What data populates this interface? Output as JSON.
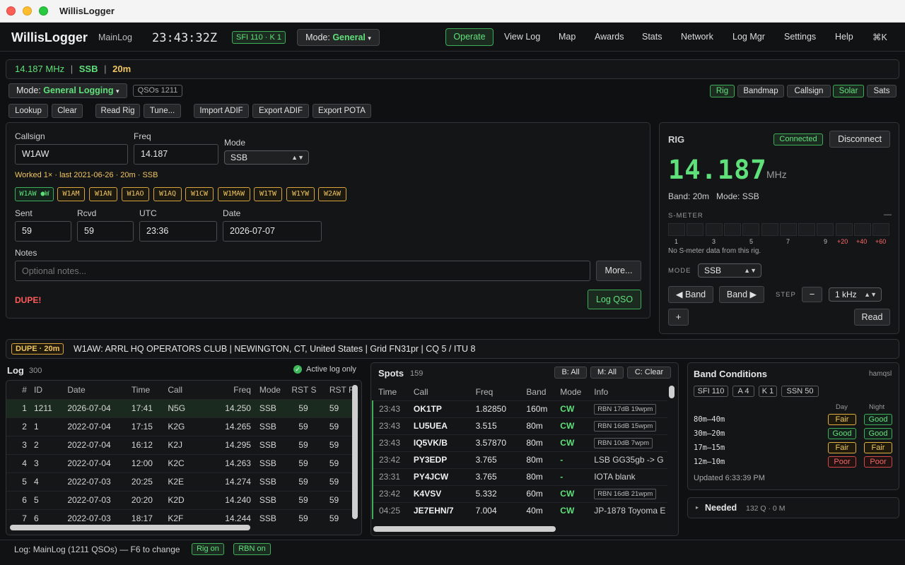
{
  "window": {
    "title": "WillisLogger"
  },
  "header": {
    "app_name": "WillisLogger",
    "log_name": "MainLog",
    "clock": "23:43:32Z",
    "sfi_badge": "SFI 110 · K 1",
    "mode_label": "Mode:",
    "mode_value": "General",
    "mode_arrow": "▾"
  },
  "nav": {
    "items": [
      "Operate",
      "View Log",
      "Map",
      "Awards",
      "Stats",
      "Network",
      "Log Mgr",
      "Settings",
      "Help",
      "⌘K"
    ],
    "active": "Operate"
  },
  "freqbar": {
    "freq": "14.187 MHz",
    "sep": "|",
    "mode": "SSB",
    "band": "20m"
  },
  "modebar": {
    "label": "Mode:",
    "value": "General Logging",
    "arrow": "▾",
    "qsos": "QSOs 1211"
  },
  "toggles": [
    "Rig",
    "Bandmap",
    "Callsign",
    "Solar",
    "Sats"
  ],
  "toolbar": [
    "Lookup",
    "Clear",
    "Read Rig",
    "Tune...",
    "Import ADIF",
    "Export ADIF",
    "Export POTA"
  ],
  "entry": {
    "callsign_label": "Callsign",
    "callsign": "W1AW",
    "freq_label": "Freq",
    "freq": "14.187",
    "mode_label": "Mode",
    "mode": "SSB",
    "worked": "Worked 1× · last 2021-06-26 · 20m · SSB",
    "chips": [
      "W1AW ●W",
      "W1AM",
      "W1AN",
      "W1AO",
      "W1AQ",
      "W1CW",
      "W1MAW",
      "W1TW",
      "W1YW",
      "W2AW"
    ],
    "sent_label": "Sent",
    "sent": "59",
    "rcvd_label": "Rcvd",
    "rcvd": "59",
    "utc_label": "UTC",
    "utc": "23:36",
    "date_label": "Date",
    "date": "2026-07-07",
    "notes_label": "Notes",
    "notes_placeholder": "Optional notes...",
    "more": "More...",
    "dupe": "DUPE!",
    "log_qso": "Log QSO"
  },
  "rig": {
    "title": "RIG",
    "status": "Connected",
    "disconnect": "Disconnect",
    "freq": "14.187",
    "unit": "MHz",
    "band_mode": "Band: 20m   Mode: SSB",
    "smeter_label": "S-METER",
    "smeter_dash": "—",
    "smeter_scale": [
      "1",
      "3",
      "5",
      "7",
      "9",
      "+20",
      "+40",
      "+60"
    ],
    "smeter_msg": "No S-meter data from this rig.",
    "mode_label": "MODE",
    "mode": "SSB",
    "band_down": "◀ Band",
    "band_up": "Band ▶",
    "step_label": "STEP",
    "minus": "−",
    "step": "1 kHz",
    "plus": "+",
    "read": "Read"
  },
  "infobar": {
    "badge": "DUPE · 20m",
    "text": "W1AW: ARRL HQ OPERATORS CLUB | NEWINGTON, CT, United States | Grid FN31pr | CQ 5 / ITU 8"
  },
  "log": {
    "title": "Log",
    "count": "300",
    "active_only": "Active log only",
    "columns": [
      "#",
      "ID",
      "Date",
      "Time",
      "Call",
      "Freq",
      "Mode",
      "RST S",
      "RST R"
    ],
    "rows": [
      [
        "1",
        "1211",
        "2026-07-04",
        "17:41",
        "N5G",
        "14.250",
        "SSB",
        "59",
        "59"
      ],
      [
        "2",
        "1",
        "2022-07-04",
        "17:15",
        "K2G",
        "14.265",
        "SSB",
        "59",
        "59"
      ],
      [
        "3",
        "2",
        "2022-07-04",
        "16:12",
        "K2J",
        "14.295",
        "SSB",
        "59",
        "59"
      ],
      [
        "4",
        "3",
        "2022-07-04",
        "12:00",
        "K2C",
        "14.263",
        "SSB",
        "59",
        "59"
      ],
      [
        "5",
        "4",
        "2022-07-03",
        "20:25",
        "K2E",
        "14.274",
        "SSB",
        "59",
        "59"
      ],
      [
        "6",
        "5",
        "2022-07-03",
        "20:20",
        "K2D",
        "14.240",
        "SSB",
        "59",
        "59"
      ],
      [
        "7",
        "6",
        "2022-07-03",
        "18:17",
        "K2F",
        "14.244",
        "SSB",
        "59",
        "59"
      ]
    ]
  },
  "spots": {
    "title": "Spots",
    "count": "159",
    "filters": [
      "B: All",
      "M: All",
      "C: Clear"
    ],
    "columns": [
      "Time",
      "Call",
      "Freq",
      "Band",
      "Mode",
      "Info"
    ],
    "rows": [
      {
        "time": "23:43",
        "call": "OK1TP",
        "freq": "1.82850",
        "band": "160m",
        "mode": "CW",
        "info": "RBN 17dB 19wpm",
        "rbn": true
      },
      {
        "time": "23:43",
        "call": "LU5UEA",
        "freq": "3.515",
        "band": "80m",
        "mode": "CW",
        "info": "RBN 16dB 15wpm",
        "rbn": true
      },
      {
        "time": "23:43",
        "call": "IQ5VK/B",
        "freq": "3.57870",
        "band": "80m",
        "mode": "CW",
        "info": "RBN 10dB 7wpm",
        "rbn": true
      },
      {
        "time": "23:42",
        "call": "PY3EDP",
        "freq": "3.765",
        "band": "80m",
        "mode": "-",
        "info": "LSB GG35gb -> G",
        "rbn": false
      },
      {
        "time": "23:31",
        "call": "PY4JCW",
        "freq": "3.765",
        "band": "80m",
        "mode": "-",
        "info": "IOTA blank",
        "rbn": false
      },
      {
        "time": "23:42",
        "call": "K4VSV",
        "freq": "5.332",
        "band": "60m",
        "mode": "CW",
        "info": "RBN 16dB 21wpm",
        "rbn": true
      },
      {
        "time": "04:25",
        "call": "JE7EHN/7",
        "freq": "7.004",
        "band": "40m",
        "mode": "CW",
        "info": "JP-1878 Toyoma E",
        "rbn": false
      }
    ]
  },
  "conditions": {
    "title": "Band Conditions",
    "source": "hamqsl",
    "pills": [
      "SFI 110",
      "A 4",
      "K 1",
      "SSN 50"
    ],
    "day": "Day",
    "night": "Night",
    "rows": [
      {
        "band": "80m–40m",
        "day": "Fair",
        "night": "Good"
      },
      {
        "band": "30m–20m",
        "day": "Good",
        "night": "Good"
      },
      {
        "band": "17m–15m",
        "day": "Fair",
        "night": "Fair"
      },
      {
        "band": "12m–10m",
        "day": "Poor",
        "night": "Poor"
      }
    ],
    "updated": "Updated 6:33:39 PM"
  },
  "needed": {
    "arrow": "▸",
    "title": "Needed",
    "meta": "132 Q · 0 M"
  },
  "statusbar": {
    "text": "Log: MainLog (1211 QSOs) — F6 to change",
    "rig": "Rig on",
    "rbn": "RBN on"
  },
  "colors": {
    "accent_green": "#5fe07a",
    "amber": "#f1c560",
    "dupe_red": "#ff5a5a",
    "bg": "#0f1012"
  }
}
